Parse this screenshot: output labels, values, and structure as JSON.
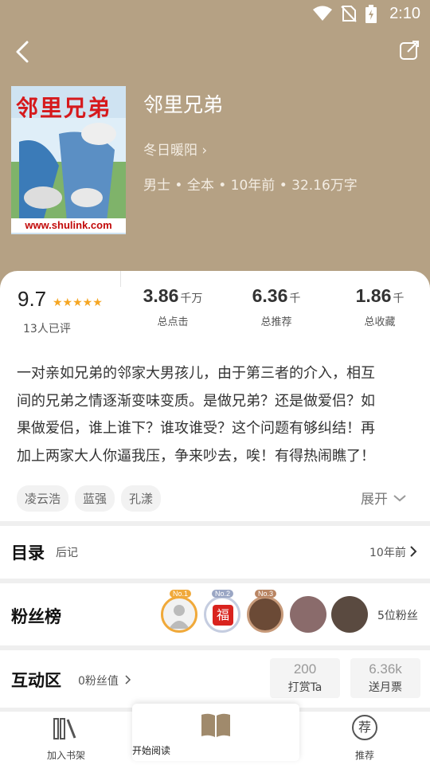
{
  "status_bar": {
    "time": "2:10"
  },
  "book": {
    "title": "邻里兄弟",
    "author": "冬日暖阳 ›",
    "meta": "男士 • 全本 • 10年前 • 32.16万字",
    "cover_title": "邻里兄弟",
    "cover_url": "www.shulink.com"
  },
  "rating": {
    "score": "9.7",
    "stars": 5,
    "stars_text": "★★★★★",
    "count_label": "13人已评"
  },
  "stats": [
    {
      "value": "3.86",
      "unit": "千万",
      "label": "总点击"
    },
    {
      "value": "6.36",
      "unit": "千",
      "label": "总推荐"
    },
    {
      "value": "1.86",
      "unit": "千",
      "label": "总收藏"
    }
  ],
  "description_lines": [
    "一对亲如兄弟的邻家大男孩儿，由于第三者的介入，相互",
    "间的兄弟之情逐渐变味变质。是做兄弟？还是做爱侣？如",
    "果做爱侣，谁上谁下？谁攻谁受？这个问题有够纠结！再",
    "加上两家大人你逼我压，争来吵去，唉！有得热闹瞧了！"
  ],
  "tags": [
    "凌云浩",
    "蓝强",
    "孔漾"
  ],
  "expand_label": "展开",
  "toc": {
    "title": "目录",
    "latest": "后记",
    "time": "10年前"
  },
  "fans": {
    "title": "粉丝榜",
    "count_label": "5位粉丝",
    "badges": [
      "No.1",
      "No.2",
      "No.3"
    ]
  },
  "interact": {
    "title": "互动区",
    "fan_value": "0粉丝值",
    "reward": {
      "num": "200",
      "label": "打赏Ta"
    },
    "monthly": {
      "num": "6.36k",
      "label": "送月票"
    }
  },
  "bottom_nav": {
    "shelf": "加入书架",
    "read": "开始阅读",
    "recommend": "推荐",
    "recommend_glyph": "荐"
  },
  "colors": {
    "hero_bg": "#b5a184",
    "star": "#f5a623",
    "gold_badge": "#f0a93a"
  }
}
